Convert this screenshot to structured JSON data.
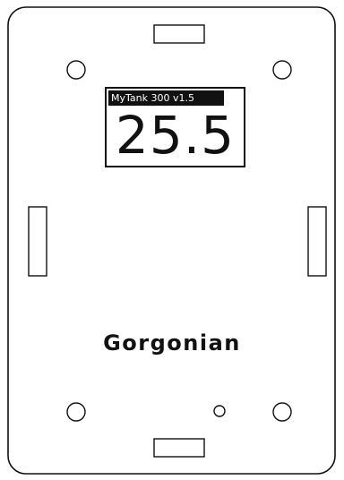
{
  "device": {
    "screen": {
      "title": "MyTank 300  v1.5",
      "reading": "25.5"
    },
    "brand": "Gorgonian"
  },
  "colors": {
    "outline": "#111111",
    "background": "#ffffff",
    "title_bar_text": "#ffffff"
  }
}
